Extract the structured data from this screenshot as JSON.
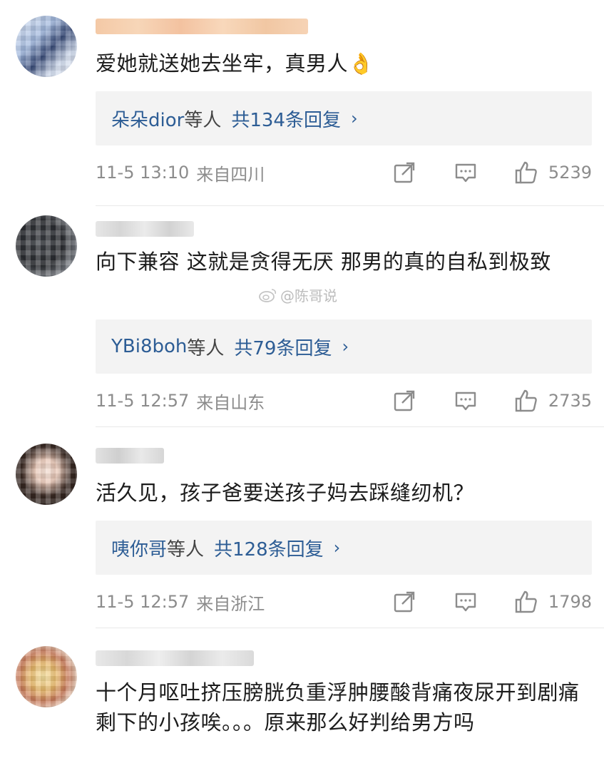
{
  "comments": [
    {
      "text": "爱她就送她去坐牢，真男人👌",
      "reply_names": "朵朵dior",
      "reply_etc": "等人",
      "reply_count": "共134条回复",
      "chevron": "›",
      "time": "11-5 13:10",
      "location": "来自四川",
      "likes": "5239"
    },
    {
      "text": "向下兼容 这就是贪得无厌 那男的真的自私到极致",
      "reply_names": "YBi8boh",
      "reply_etc": "等人",
      "reply_count": "共79条回复",
      "chevron": "›",
      "time": "11-5 12:57",
      "location": "来自山东",
      "likes": "2735"
    },
    {
      "text": "活久见，孩子爸要送孩子妈去踩缝纫机？",
      "reply_names": "咦你哥",
      "reply_etc": "等人",
      "reply_count": "共128条回复",
      "chevron": "›",
      "time": "11-5 12:57",
      "location": "来自浙江",
      "likes": "1798"
    },
    {
      "text": "十个月呕吐挤压膀胱负重浮肿腰酸背痛夜尿开到剧痛剩下的小孩唉。。。原来那么好判给男方吗"
    }
  ],
  "watermark": "@陈哥说",
  "icons": {
    "share": "share-icon",
    "comment": "comment-icon",
    "like": "thumbs-up-icon",
    "watermark": "weibo-logo-icon"
  },
  "colors": {
    "link": "#2d5d95",
    "meta": "#8c8c8c",
    "reply_bg": "#f3f3f3"
  }
}
